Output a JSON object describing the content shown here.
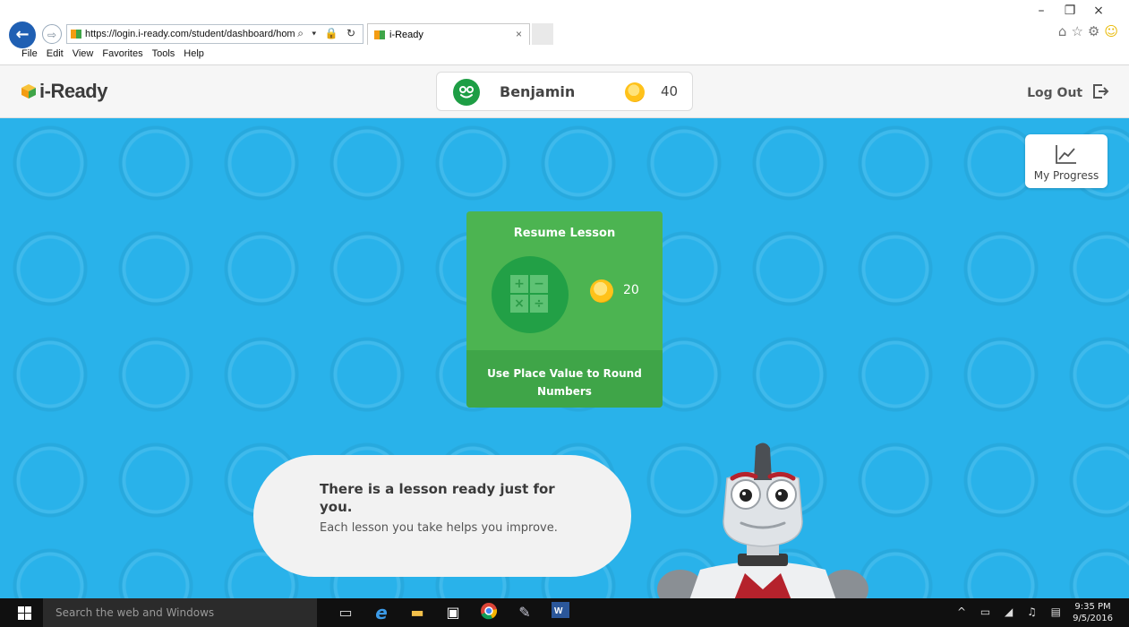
{
  "browser": {
    "url": "https://login.i-ready.com/student/dashboard/hom",
    "tab_title": "i-Ready",
    "tab_close": "×",
    "back_glyph": "←",
    "forward_glyph": "⇨",
    "address_tools": "⌕ ▾ 🔒 ↻",
    "menu": [
      "File",
      "Edit",
      "View",
      "Favorites",
      "Tools",
      "Help"
    ],
    "window_controls": [
      "–",
      "❐",
      "×"
    ],
    "toolbar_icons": [
      "⌂",
      "☆",
      "⚙"
    ],
    "smiley": "☺"
  },
  "app": {
    "logo_text": "i-Ready",
    "user_name": "Benjamin",
    "coins": "40",
    "logout_label": "Log Out",
    "my_progress_label": "My Progress"
  },
  "lesson": {
    "title": "Resume Lesson",
    "coins": "20",
    "name": "Use Place Value to Round Numbers",
    "math_symbols": [
      "+",
      "−",
      "×",
      "÷"
    ]
  },
  "message": {
    "headline": "There is a lesson ready just for you.",
    "subtext": "Each lesson you take helps you improve."
  },
  "taskbar": {
    "search_placeholder": "Search the web and Windows",
    "tray_icons": "^ ▭ ◢ ♫ ▤",
    "time": "9:35 PM",
    "date": "9/5/2016"
  },
  "colors": {
    "stage": "#29b2ea",
    "card": "#4cb451",
    "card_footer": "#3fa548",
    "avatar": "#1e9e45",
    "coin": "#ffc21a"
  }
}
